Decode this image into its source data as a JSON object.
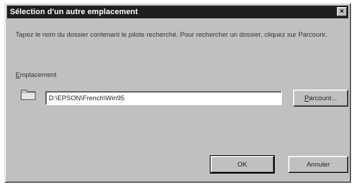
{
  "window": {
    "title": "Sélection d'un autre emplacement",
    "close_label": "×"
  },
  "instructions": "Tapez le nom du dossier contenant le pilote recherché. Pour rechercher un dossier, cliquez sur Parcourir.",
  "location": {
    "label_first": "E",
    "label_rest": "mplacement",
    "path_value": "D:\\EPSON\\French\\Win95",
    "folder_icon": "folder-icon"
  },
  "buttons": {
    "browse_first": "P",
    "browse_rest": "arcourir...",
    "ok": "OK",
    "cancel": "Annuler"
  },
  "colors": {
    "titlebar": "#1f1f1f",
    "face": "#c0c0c0"
  }
}
